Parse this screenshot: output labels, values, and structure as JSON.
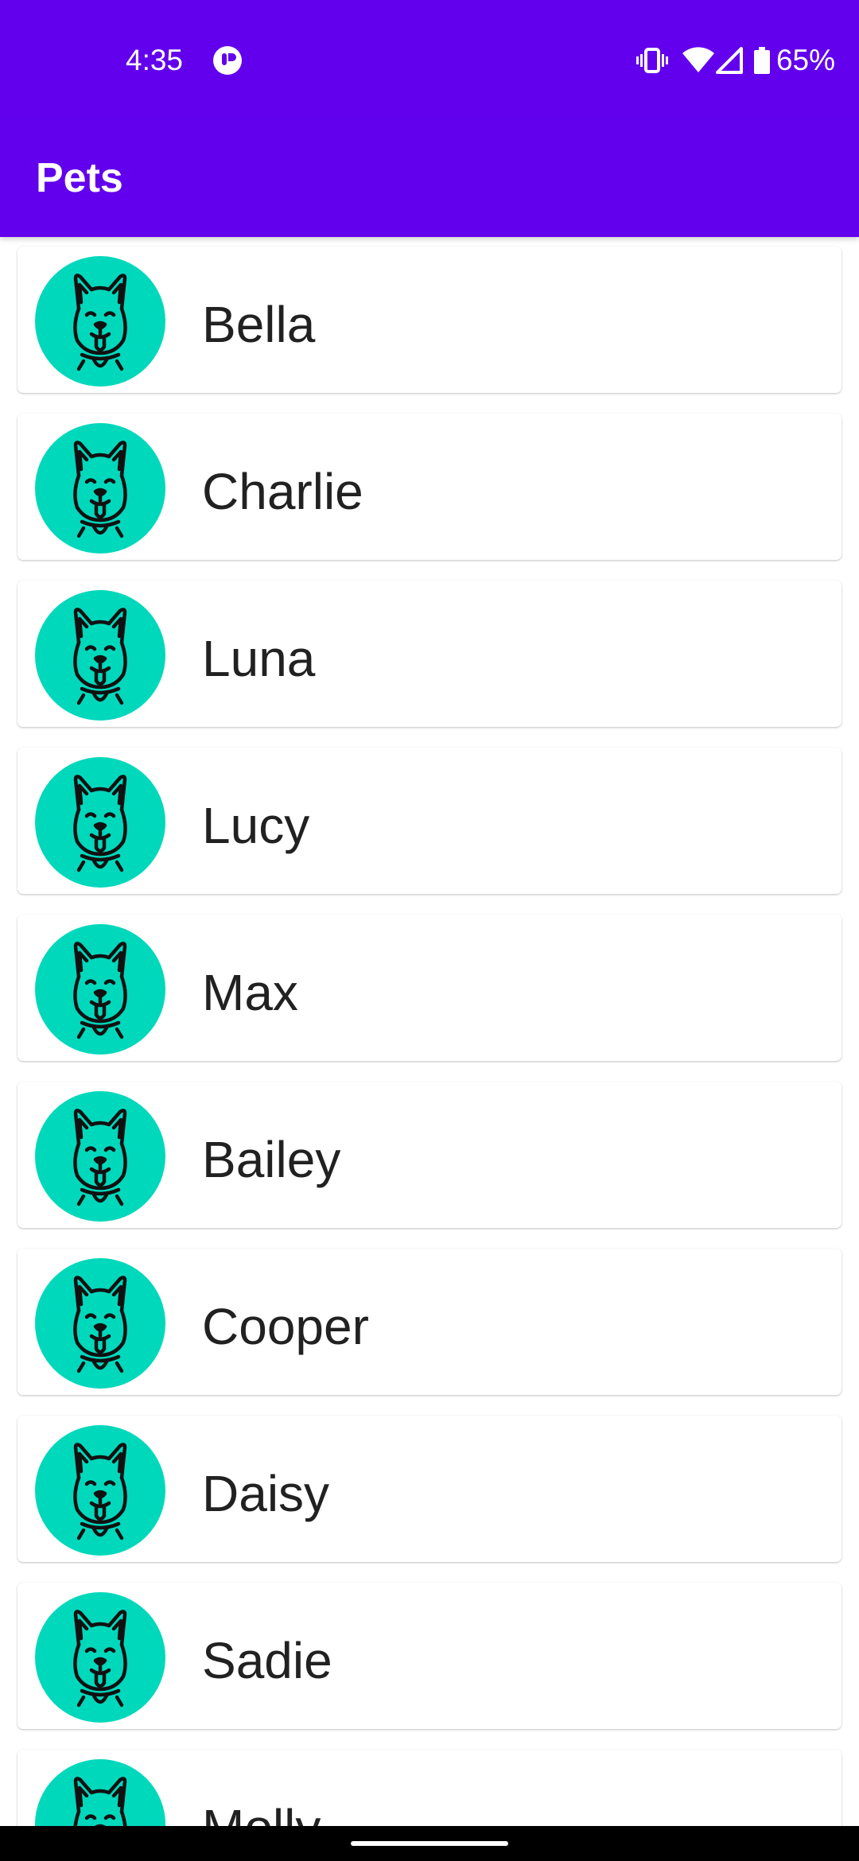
{
  "status_bar": {
    "time": "4:35",
    "battery_percent": "65%",
    "icons": [
      "app-notification-icon",
      "vibrate-icon",
      "wifi-icon",
      "cell-signal-icon",
      "battery-icon"
    ]
  },
  "app_bar": {
    "title": "Pets",
    "color": "#6200ee"
  },
  "pets": [
    {
      "name": "Bella",
      "icon": "dog-icon"
    },
    {
      "name": "Charlie",
      "icon": "dog-icon"
    },
    {
      "name": "Luna",
      "icon": "dog-icon"
    },
    {
      "name": "Lucy",
      "icon": "dog-icon"
    },
    {
      "name": "Max",
      "icon": "dog-icon"
    },
    {
      "name": "Bailey",
      "icon": "dog-icon"
    },
    {
      "name": "Cooper",
      "icon": "dog-icon"
    },
    {
      "name": "Daisy",
      "icon": "dog-icon"
    },
    {
      "name": "Sadie",
      "icon": "dog-icon"
    },
    {
      "name": "Molly",
      "icon": "dog-icon"
    }
  ],
  "colors": {
    "avatar_background": "#00d8bc",
    "text": "#212121"
  }
}
